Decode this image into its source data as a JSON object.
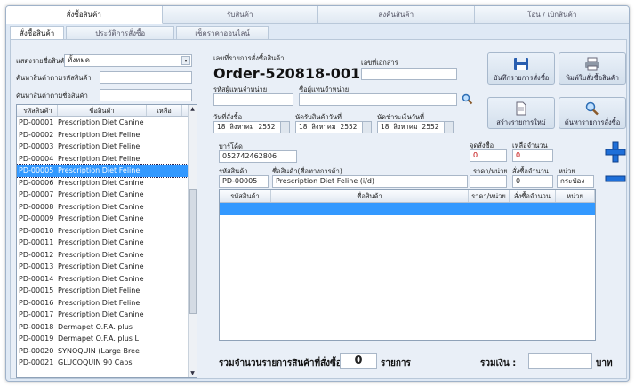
{
  "main_tabs": [
    "สั่งซื้อสินค้า",
    "รับสินค้า",
    "ส่งคืนสินค้า",
    "โอน / เบิกสินค้า"
  ],
  "sub_tabs": [
    "สั่งซื้อสินค้า",
    "ประวัติการสั่งซื้อ",
    "เช็คราคาออนไลน์"
  ],
  "left": {
    "filter_label": "แสดงรายชื่อสินค้า",
    "filter_value": "ทั้งหมด",
    "search_code_label": "ค้นหาสินค้าตามรหัสสินค้า",
    "search_name_label": "ค้นหาสินค้าตามชื่อสินค้า",
    "columns": [
      "รหัสสินค้า",
      "ชื่อสินค้า",
      "เหลือ"
    ],
    "items": [
      {
        "code": "PD-00001",
        "name": "Prescription Diet Canine"
      },
      {
        "code": "PD-00002",
        "name": "Prescription Diet Feline"
      },
      {
        "code": "PD-00003",
        "name": "Prescription Diet Feline"
      },
      {
        "code": "PD-00004",
        "name": "Prescription Diet Feline"
      },
      {
        "code": "PD-00005",
        "name": "Prescription Diet Feline"
      },
      {
        "code": "PD-00006",
        "name": "Prescription Diet Canine"
      },
      {
        "code": "PD-00007",
        "name": "Prescription Diet Canine"
      },
      {
        "code": "PD-00008",
        "name": "Prescription Diet Canine"
      },
      {
        "code": "PD-00009",
        "name": "Prescription Diet Canine"
      },
      {
        "code": "PD-00010",
        "name": "Prescription Diet Canine"
      },
      {
        "code": "PD-00011",
        "name": "Prescription Diet Canine"
      },
      {
        "code": "PD-00012",
        "name": "Prescription Diet Canine"
      },
      {
        "code": "PD-00013",
        "name": "Prescription Diet Canine"
      },
      {
        "code": "PD-00014",
        "name": "Prescription Diet Canine"
      },
      {
        "code": "PD-00015",
        "name": "Prescription Diet Feline"
      },
      {
        "code": "PD-00016",
        "name": "Prescription Diet Feline"
      },
      {
        "code": "PD-00017",
        "name": "Prescription Diet Canine"
      },
      {
        "code": "PD-00018",
        "name": "Dermapet O.F.A. plus"
      },
      {
        "code": "PD-00019",
        "name": "Dermapet O.F.A. plus L"
      },
      {
        "code": "PD-00020",
        "name": "SYNOQUIN (Large Bree"
      },
      {
        "code": "PD-00021",
        "name": "GLUCOQUIN 90 Caps"
      }
    ]
  },
  "order": {
    "order_no_label": "เลขที่รายการสั่งซื้อสินค้า",
    "order_no": "Order-520818-001",
    "doc_no_label": "เลขที่เอกสาร",
    "vendor_code_label": "รหัสผู้แทนจำหน่าย",
    "vendor_name_label": "ชื่อผู้แทนจำหน่าย",
    "order_date_label": "วันที่สั่งซื้อ",
    "receive_date_label": "นัดรับสินค้าวันที่",
    "pay_date_label": "นัดชำระเงินวันที่",
    "date_day": "18",
    "date_month": "สิงหาคม",
    "date_year": "2552"
  },
  "buttons": {
    "save": "บันทึกรายการสั่งซื้อ",
    "print": "พิมพ์ใบสั่งซื้อสินค้า",
    "new": "สร้างรายการใหม่",
    "search": "ค้นหารายการสั่งซื้อ"
  },
  "item": {
    "barcode_label": "บาร์โค้ด",
    "barcode": "052742462806",
    "reorder_label": "จุดสั่งซื้อ",
    "reorder_value": "0",
    "remain_label": "เหลือจำนวน",
    "remain_value": "0",
    "code_label": "รหัสสินค้า",
    "code": "PD-00005",
    "name_label": "ชื่อสินค้า(ชื่อทางการค้า)",
    "name": "Prescription Diet Feline (i/d)",
    "price_label": "ราคา/หน่วย",
    "qty_label": "สั่งซื้อจำนวน",
    "qty": "0",
    "unit_label": "หน่วย",
    "unit": "กระป๋อง"
  },
  "grid_columns": [
    "รหัสสินค้า",
    "ชื่อสินค้า",
    "ราคา/หน่วย",
    "สั่งซื้อจำนวน",
    "หน่วย"
  ],
  "summary": {
    "total_items_label": "รวมจำนวนรายการสินค้าที่สั่งซื้อ :",
    "total_items": "0",
    "items_unit": "รายการ",
    "total_money_label": "รวมเงิน :",
    "money_unit": "บาท"
  },
  "colors": {
    "selection": "#3399ff",
    "accent": "#1e6fd9",
    "warning_text": "#c00000"
  }
}
